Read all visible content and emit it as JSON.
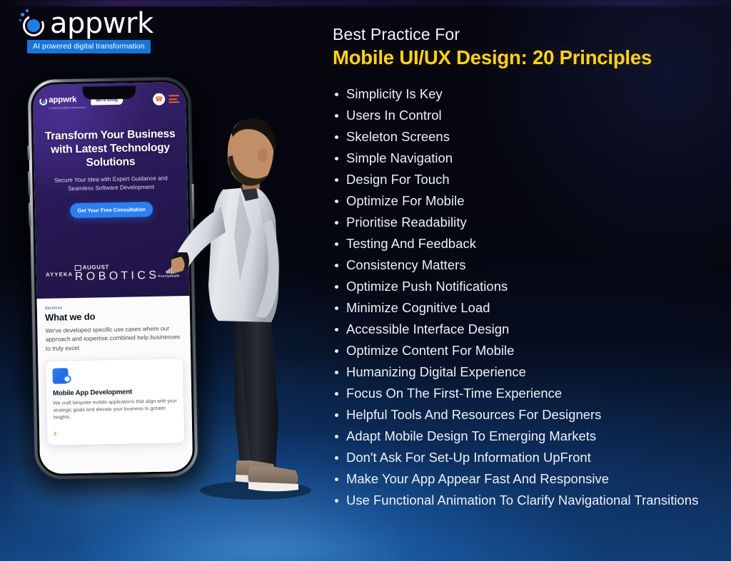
{
  "brand": {
    "logo_word": "appwrk",
    "tagline": "AI powered digital transformation",
    "logo_icon": "appwrk-ring-logo",
    "accent_blue": "#1677d8",
    "accent_yellow": "#FFD21A"
  },
  "content": {
    "eyebrow": "Best Practice For",
    "headline": "Mobile UI/UX Design: 20 Principles",
    "principles": [
      "Simplicity Is Key",
      "Users In Control",
      "Skeleton Screens",
      "Simple Navigation",
      "Design For Touch",
      "Optimize For Mobile",
      "Prioritise Readability",
      "Testing And Feedback",
      "Consistency Matters",
      "Optimize Push Notifications",
      "Minimize Cognitive Load",
      "Accessible Interface Design",
      "Optimize Content For Mobile",
      "Humanizing Digital Experience",
      "Focus On The First-Time Experience",
      "Helpful Tools And Resources For Designers",
      "Adapt Mobile Design To Emerging Markets",
      "Don't Ask For Set-Up Information UpFront",
      "Make Your App Appear Fast And Responsive",
      "Use Functional Animation To Clarify Navigational Transitions"
    ]
  },
  "phone": {
    "header": {
      "logo_word": "appwrk",
      "logo_tagline": "AI powered digital transformation",
      "hiring_badge": "We're hiring",
      "call_icon": "phone-icon",
      "menu_icon": "hamburger-menu-icon"
    },
    "hero": {
      "heading": "Transform Your Business with Latest Technology Solutions",
      "subheading": "Secure Your Idea with Expert Guidance and Seamless Software Development",
      "cta": "Get Your Free Consultation"
    },
    "brands": [
      {
        "name": "AYYEKA",
        "sub": ""
      },
      {
        "name": "AUGUST",
        "sub": "R O B O T I C S"
      },
      {
        "name": "PriorityHealth",
        "sub": ""
      }
    ],
    "services": {
      "kicker": "Services",
      "title": "What we do",
      "body": "We've developed specific use cases where our approach and expertise combined help businesses to truly excel.",
      "card": {
        "icon": "mobile-app-development-icon",
        "title": "Mobile App Development",
        "body": "We craft bespoke mobile applications that align with your strategic goals and elevate your business to greater heights.",
        "arrow": "›"
      }
    }
  }
}
